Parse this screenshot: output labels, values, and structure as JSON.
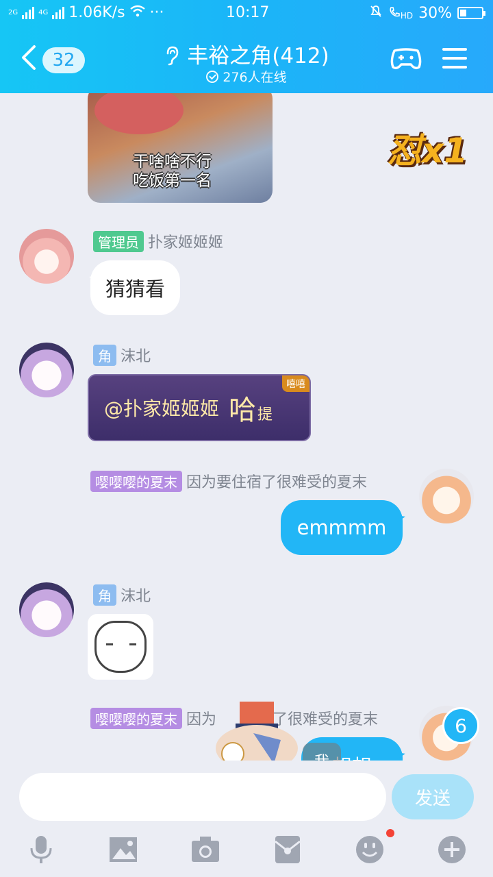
{
  "status_bar": {
    "net1": "2G",
    "net2": "4G",
    "speed": "1.06K/s",
    "dots": "···",
    "time": "10:17",
    "hd": "HD",
    "battery": "30%",
    "battery_level": 0.3
  },
  "header": {
    "back_count": "32",
    "title": "丰裕之角(412)",
    "online": "276人在线"
  },
  "chat": {
    "meme_caption_1": "干啥啥不行",
    "meme_caption_2": "吃饭第一名",
    "combo": "怼x1",
    "messages": [
      {
        "tag": "管理员",
        "name": "扑家姬姬姬",
        "text": "猜猜看"
      },
      {
        "tag": "角",
        "name": "沫北",
        "text": "@扑家姬姬姬",
        "big": "哈",
        "small": "提",
        "corner": "嘻嘻"
      },
      {
        "tag": "嘤嘤嘤的夏末",
        "name": "因为要住宿了很难受的夏末",
        "text": "emmmm"
      },
      {
        "tag": "角",
        "name": "沫北"
      },
      {
        "tag": "嘤嘤嘤的夏末",
        "name_partial_1": "因为",
        "name_partial_2": "了很难受的夏末",
        "text": "想想"
      }
    ],
    "unread": "6",
    "me_chip": "我"
  },
  "input": {
    "placeholder": "",
    "send": "发送"
  },
  "toolbar": {
    "icons": [
      "microphone-icon",
      "image-icon",
      "camera-icon",
      "red-packet-icon",
      "emoji-icon",
      "plus-icon"
    ]
  },
  "colors": {
    "header": "#1bb5f8",
    "out_bubble": "#22b6f6",
    "admin_tag": "#4fc98f",
    "role_tag": "#8dbcf0",
    "title_tag": "#b58de3"
  }
}
